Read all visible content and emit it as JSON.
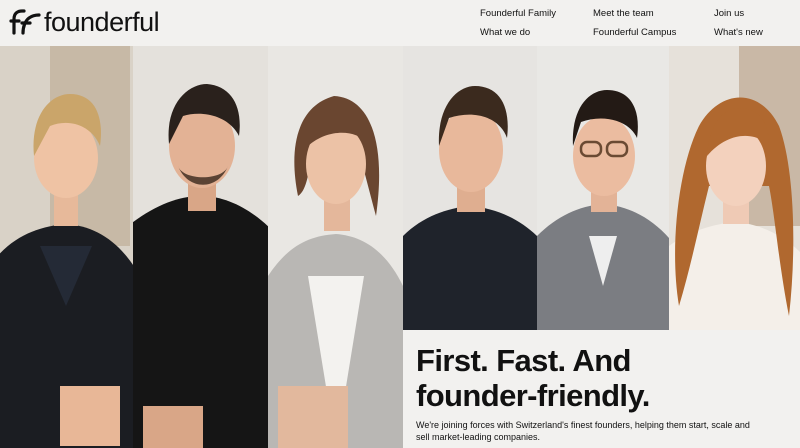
{
  "brand": {
    "name": "founderful",
    "logo_icon": "ff-monogram-icon"
  },
  "nav": {
    "items": [
      {
        "label": "Founderful Family"
      },
      {
        "label": "Meet the team"
      },
      {
        "label": "Join us"
      },
      {
        "label": "What we do"
      },
      {
        "label": "Founderful Campus"
      },
      {
        "label": "What's new"
      }
    ]
  },
  "hero": {
    "title_line1": "First. Fast. And",
    "title_line2": "founder-friendly.",
    "subtitle": "We're joining forces with Switzerland's finest founders, helping them start, scale and sell market-leading companies."
  },
  "colors": {
    "background": "#f2f1ef",
    "text": "#111111"
  }
}
